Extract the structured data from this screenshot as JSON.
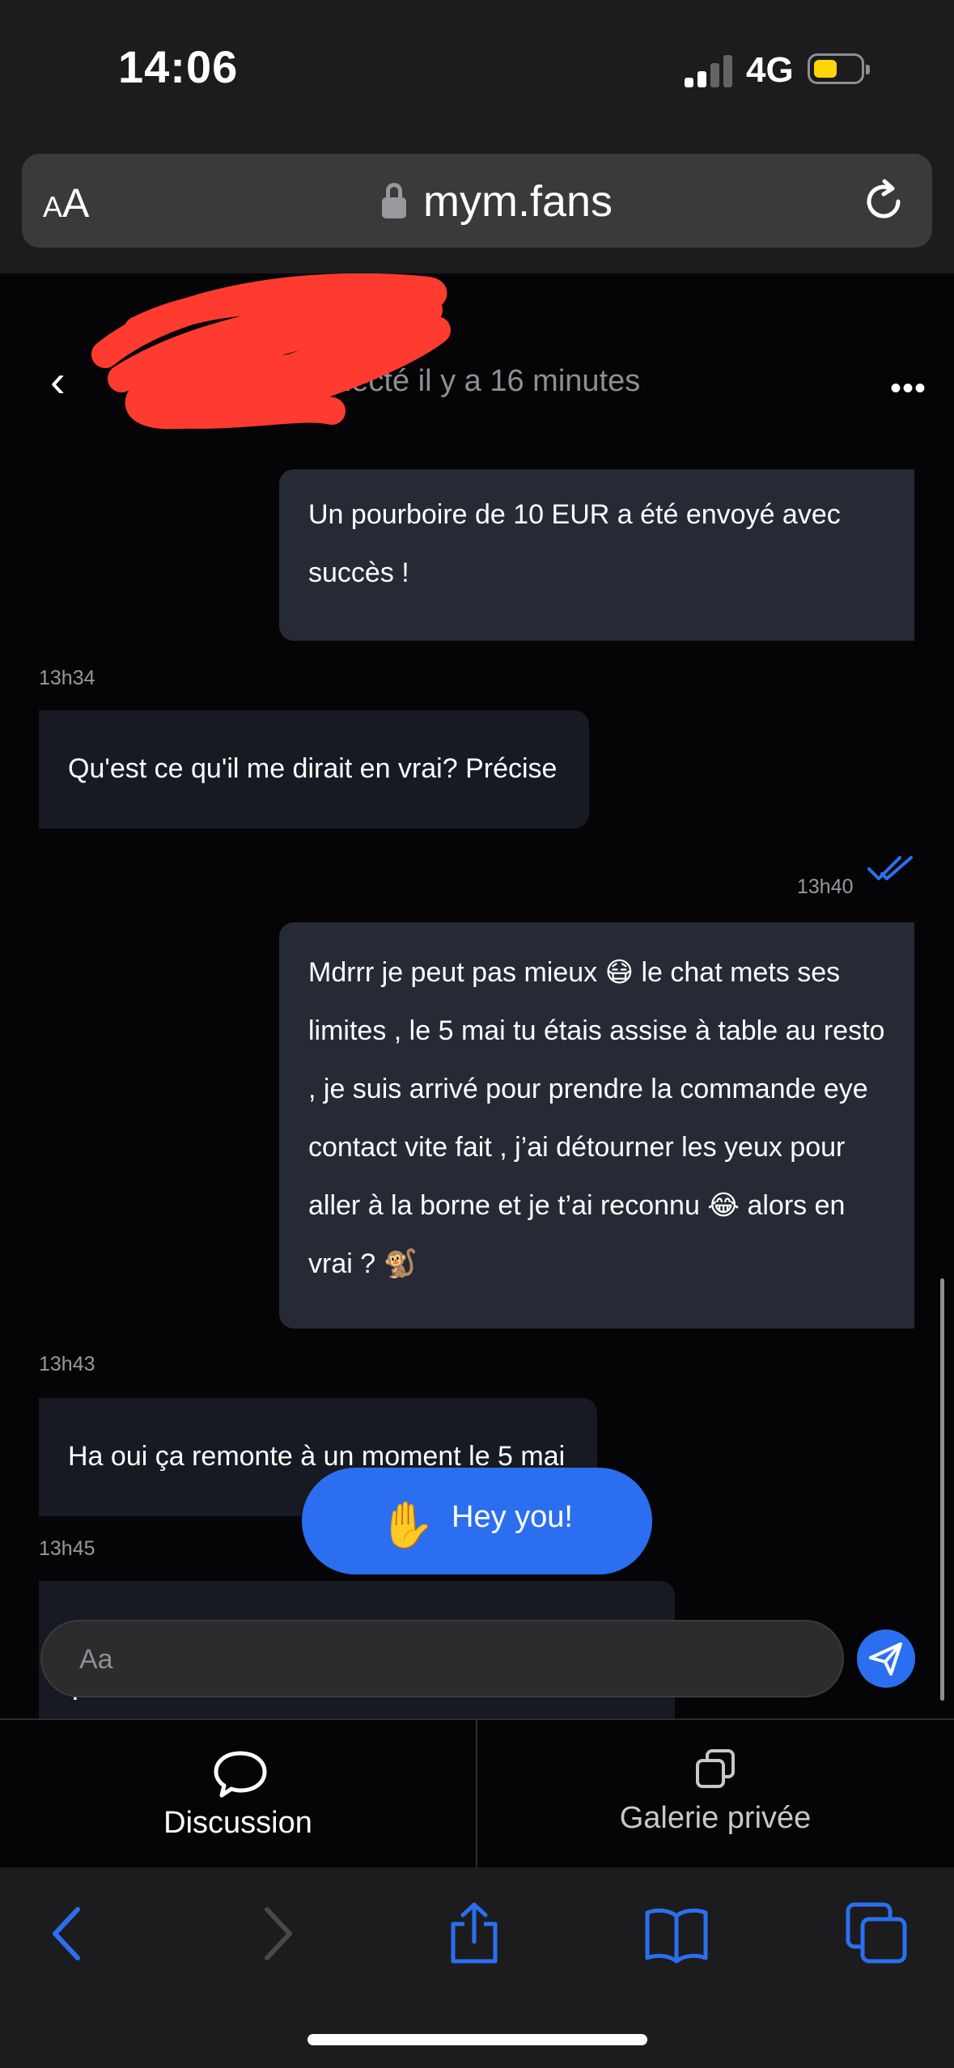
{
  "status_bar": {
    "time": "14:06",
    "network": "4G",
    "signal_bars_active": 2,
    "signal_bars_total": 4,
    "battery_level": 0.4
  },
  "browser": {
    "text_size_label_small": "A",
    "text_size_label_large": "A",
    "domain": "mym.fans"
  },
  "chat_header": {
    "status": "nnecté il y a 16 minutes"
  },
  "messages": [
    {
      "direction": "out",
      "text": "Un pourboire de 10 EUR a été envoyé avec succès !"
    },
    {
      "direction": "in",
      "time": "13h34",
      "text": "Qu'est ce qu'il me dirait en vrai? Précise"
    },
    {
      "direction": "out",
      "time": "13h40",
      "read": true,
      "text": "Mdrrr je peut pas mieux 😷 le chat mets ses limites , le 5 mai tu étais assise à table au resto , je suis arrivé pour prendre la commande eye contact vite fait , j’ai détourner les yeux pour aller à la borne et je t’ai reconnu 😂 alors en vrai ? 🐒"
    },
    {
      "direction": "in",
      "time": "13h43",
      "text": "Ha oui ça remonte à un moment le 5 mai"
    },
    {
      "direction": "in",
      "time": "13h45",
      "text": "?"
    }
  ],
  "hey_button": {
    "emoji": "✋",
    "label": "Hey you!"
  },
  "composer": {
    "placeholder": "Aa"
  },
  "tabs": [
    {
      "label": "Discussion",
      "icon": "chat-bubble-icon",
      "active": true
    },
    {
      "label": "Galerie privée",
      "icon": "gallery-icon",
      "active": false
    }
  ],
  "toolbar_icons": [
    "back-arrow-icon",
    "forward-arrow-icon",
    "share-icon",
    "bookmarks-icon",
    "tabs-icon"
  ],
  "colors": {
    "accent": "#2b6ff0",
    "outgoing_bubble": "#252a34",
    "incoming_bubble": "#171a22",
    "redaction": "#ff3b30"
  }
}
